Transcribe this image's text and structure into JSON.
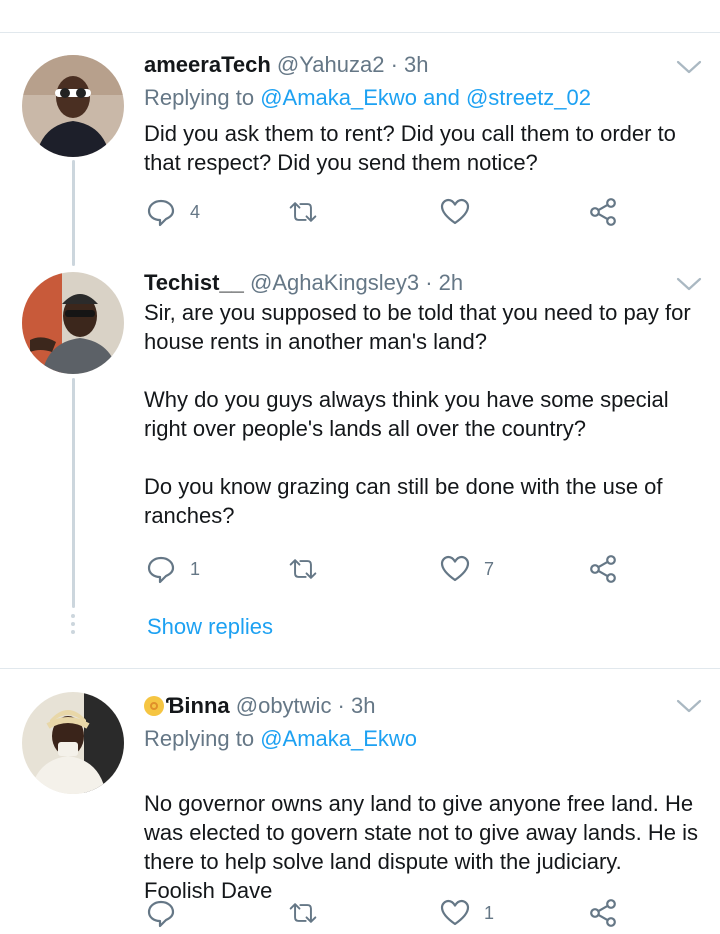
{
  "tweets": [
    {
      "name": "ameeraTech",
      "handle": "@Yahuza2 · 3h",
      "replying_prefix": "Replying to ",
      "replying_mentions": "@Amaka_Ekwo and @streetz_02",
      "text": [
        "Did you ask them to rent? Did you call them to order to that respect? Did you send them notice?"
      ],
      "reply_count": "4",
      "retweet_count": "",
      "like_count": ""
    },
    {
      "name": "Techist__",
      "handle": "@AghaKingsley3 · 2h",
      "text": [
        "Sir, are you supposed to be told that you need to pay for house rents in another man's land?",
        "Why do you guys always think you have some special right over people's lands all over the country?",
        "Do you know grazing can still be done with the use of ranches?"
      ],
      "reply_count": "1",
      "retweet_count": "",
      "like_count": "7"
    },
    {
      "name": "Ɓinna ",
      "handle": "@obytwic · 3h",
      "replying_prefix": "Replying to ",
      "replying_mentions": "@Amaka_Ekwo",
      "text": [
        "No governor owns any land to give anyone free land. He was elected to govern state not to give away lands. He is there to help solve land dispute with the judiciary.\nFoolish Dave"
      ],
      "reply_count": "",
      "retweet_count": "",
      "like_count": "1"
    }
  ],
  "show_replies_label": "Show replies",
  "icons": {
    "reply": "reply-icon",
    "retweet": "retweet-icon",
    "like": "heart-icon",
    "share": "share-icon",
    "menu": "chevron-down-icon"
  },
  "colors": {
    "link": "#1da1f2",
    "secondary_text": "#657786",
    "divider": "#e1e8ed"
  }
}
